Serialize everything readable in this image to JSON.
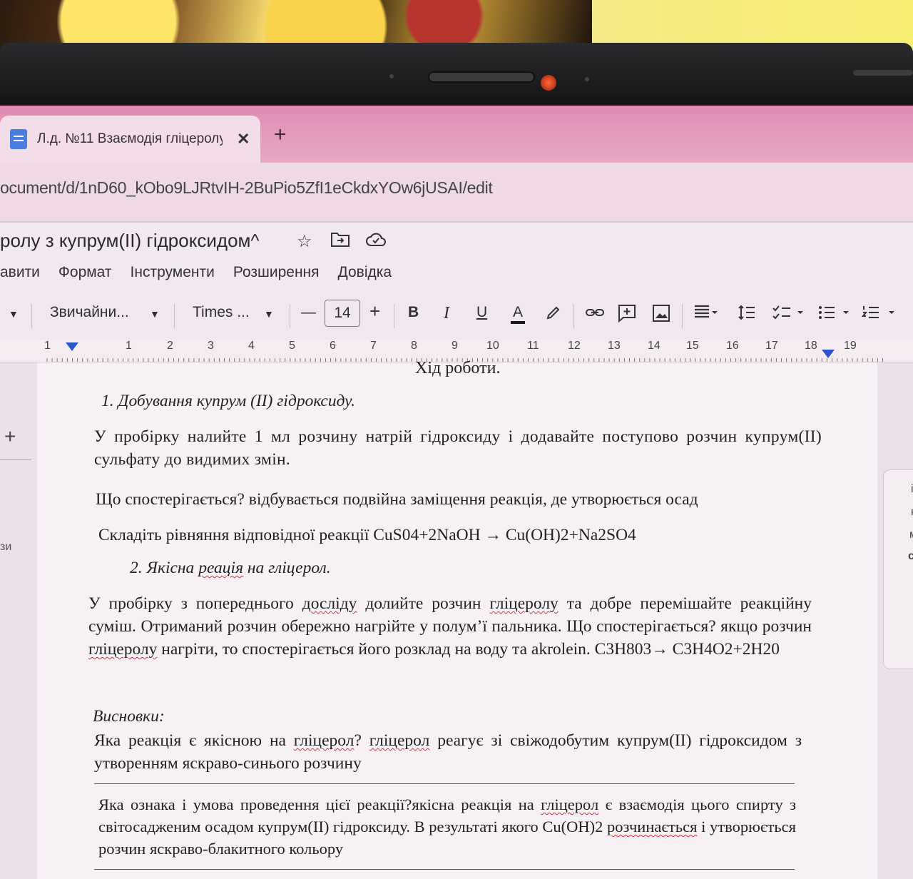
{
  "browser": {
    "tab": {
      "title": "Л.д. №11 Взаємодія гліцеролу",
      "close_glyph": "✕"
    },
    "new_tab_glyph": "+",
    "url": "ocument/d/1nD60_kObo9LJRtvIH-2BuPio5ZfI1eCkdxYOw6jUSAI/edit"
  },
  "docs": {
    "title": "ролу з купрум(II) гідроксидом^",
    "title_icons": [
      "star-icon",
      "move-to-folder-icon",
      "cloud-saved-icon"
    ],
    "menu": [
      "авити",
      "Формат",
      "Інструменти",
      "Розширення",
      "Довідка"
    ]
  },
  "toolbar": {
    "style": "Звичайни...",
    "font": "Times ...",
    "minus": "—",
    "size": "14",
    "plus": "+",
    "bold": "B",
    "italic": "I",
    "underline": "U",
    "text_color": "A",
    "accent_color": "#1a1a1a"
  },
  "ruler": [
    "1",
    "1",
    "2",
    "3",
    "4",
    "5",
    "6",
    "7",
    "8",
    "9",
    "10",
    "11",
    "12",
    "13",
    "14",
    "15",
    "16",
    "17",
    "18",
    "19"
  ],
  "side": {
    "plus": "+",
    "left_text": "зи",
    "right_letters": [
      "і",
      "к",
      "м",
      "с"
    ]
  },
  "document": {
    "heading": "Хід роботи.",
    "section1_title": "1.  Добування купрум (ІІ) гідроксиду.",
    "section1_body": "У пробірку налийте 1 мл розчину натрій гідроксиду і додавайте поступово розчин купрум(ІІ) сульфату до видимих змін.",
    "q1": "Що спостерігається?  відбувається подвійна заміщення реакція, де утворюється осад",
    "q2": "Складіть рівняння відповідної реакції CuS04+2NaOH → Cu(OH)2+Na2SO4",
    "section2_num": "2. ",
    "section2_pre": "Якісна ",
    "section2_sq": "реація",
    "section2_post": " на гліцерол.",
    "p2_a": "У пробірку з попереднього ",
    "p2_sq1": "досліду",
    "p2_b": " долийте розчин ",
    "p2_sq2": "гліцеролу",
    "p2_c": " та добре перемішайте реакційну суміш. Отриманий розчин обережно нагрійте у полум’ї пальника. Що спостерігається? якщо розчин ",
    "p2_sq3": "гліцеролу",
    "p2_d": " нагріти, то спостерігається його розклад на воду та akrolein. C3H803→ C3H4O2+2H20",
    "conclusions_label": "Висновки:",
    "c1_a": "Яка реакція є якісною на ",
    "c1_sq1": "гліцерол",
    "c1_b": "? ",
    "c1_sq2": "гліцерол",
    "c1_c": " реагує зі свіжодобутим купрум(ІІ) гідроксидом з утворенням яскраво-синього розчину",
    "c2_a": "Яка ознака і умова проведення цієї реакції?якісна реакція на ",
    "c2_sq1": "гліцерол",
    "c2_b": " є взаємодія цього спирту з світосадженим осадом купрум(ІІ) гідроксиду. В результаті якого Cu(OH)2 ",
    "c2_sq2": "розчинається",
    "c2_c": " і утворюється розчин яскраво-блакитного кольору"
  }
}
